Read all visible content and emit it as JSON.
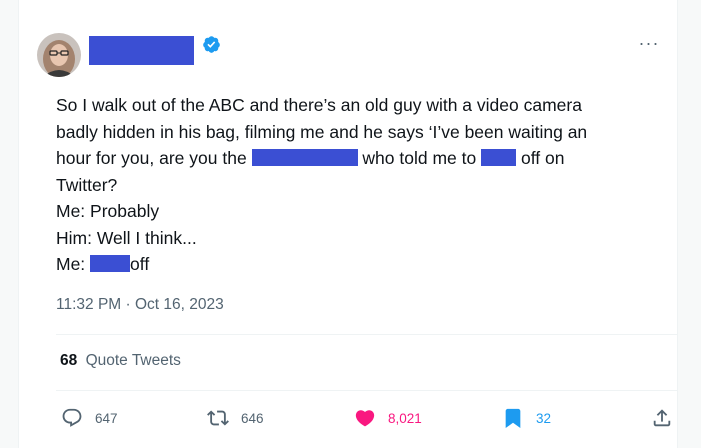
{
  "tweet": {
    "lines": [
      {
        "segments": [
          {
            "text": "So I walk out of the ABC and there’s an old guy with a video camera"
          }
        ]
      },
      {
        "segments": [
          {
            "text": "badly hidden in his bag, filming me and he says ‘I’ve been waiting an"
          }
        ]
      },
      {
        "segments": [
          {
            "text": "hour for you, are you the "
          },
          {
            "redacted": true,
            "w": 106
          },
          {
            "text": " who told me to "
          },
          {
            "redacted": true,
            "w": 35
          },
          {
            "text": " off on"
          }
        ]
      },
      {
        "segments": [
          {
            "text": "Twitter?"
          }
        ]
      },
      {
        "segments": [
          {
            "text": "Me: Probably"
          }
        ]
      },
      {
        "segments": [
          {
            "text": "Him: Well I think..."
          }
        ]
      },
      {
        "segments": [
          {
            "text": "Me: "
          },
          {
            "redacted": true,
            "w": 40
          },
          {
            "text": "off"
          }
        ]
      }
    ],
    "timestamp": "11:32 PM · Oct 16, 2023"
  },
  "stats": {
    "quote_count": "68",
    "quote_label": "Quote Tweets"
  },
  "actions": {
    "replies": "647",
    "retweets": "646",
    "likes": "8,021",
    "bookmarks": "32"
  },
  "icons": {
    "verified": "verified-badge-icon",
    "more": "more-icon",
    "reply": "reply-icon",
    "retweet": "retweet-icon",
    "like": "heart-icon",
    "bookmark": "bookmark-icon",
    "share": "share-icon"
  },
  "colors": {
    "accent": "#1d9bf0",
    "like": "#f91880",
    "redaction": "#3b4fd3",
    "muted": "#536471",
    "text": "#0f1419"
  }
}
